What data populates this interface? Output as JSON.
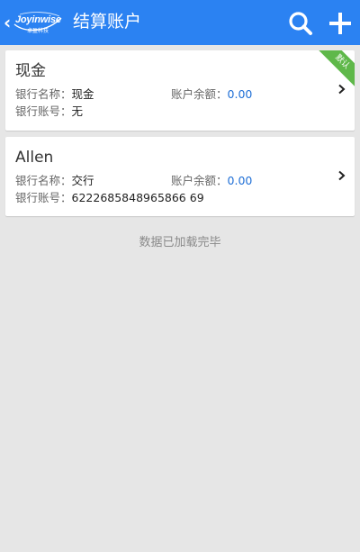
{
  "header": {
    "logo_text": "Joyinwise",
    "logo_subtext": "卓盈科技",
    "title": "结算账户",
    "icons": {
      "back": "chevron-left-icon",
      "search": "search-icon",
      "add": "plus-icon"
    },
    "colors": {
      "bar": "#2b82f2",
      "text": "#ffffff"
    }
  },
  "accounts": [
    {
      "name": "现金",
      "bank_name_label": "银行名称：",
      "bank_name": "现金",
      "balance_label": "账户余额：",
      "balance": "0.00",
      "account_no_label": "银行账号：",
      "account_no": "无",
      "badge": "默认"
    },
    {
      "name": "Allen",
      "bank_name_label": "银行名称：",
      "bank_name": "交行",
      "balance_label": "账户余额：",
      "balance": "0.00",
      "account_no_label": "银行账号：",
      "account_no": "6222685848965866 69"
    }
  ],
  "footer": {
    "status": "数据已加载完毕"
  },
  "colors": {
    "balance": "#1f6fd6",
    "badge": "#5fb84a",
    "background": "#e6e6e6"
  }
}
